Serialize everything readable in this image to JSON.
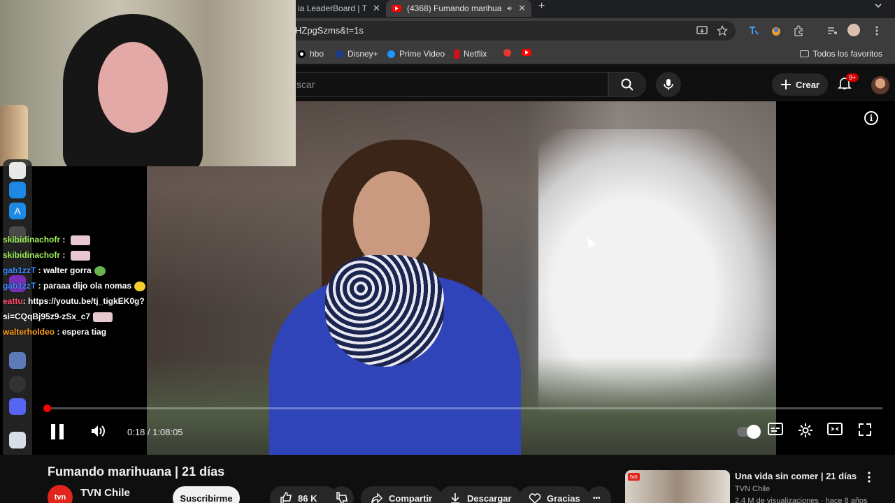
{
  "browser": {
    "tabs": [
      {
        "label": "ia LeaderBoard | T"
      },
      {
        "label": "(4368) Fumando marihua"
      }
    ],
    "close_glyph": "✕",
    "new_tab_glyph": "+",
    "url": "HZpgSzms&t=1s",
    "bookmarks": [
      {
        "label": "hbo"
      },
      {
        "label": "Disney+"
      },
      {
        "label": "Prime Video"
      },
      {
        "label": "Netflix"
      }
    ],
    "all_bookmarks": "Todos los favoritos"
  },
  "youtube": {
    "search_placeholder": "scar",
    "create_label": "Crear",
    "notifications_badge": "9+"
  },
  "chat": [
    {
      "user": "skibidinachofr",
      "sep": " : ",
      "msg": "",
      "emote": "pink",
      "color": "green"
    },
    {
      "user": "skibidinachofr",
      "sep": " : ",
      "msg": "",
      "emote": "pink",
      "color": "green"
    },
    {
      "user": "gab1zzT",
      "sep": " : ",
      "msg": "walter gorra",
      "emote": "green",
      "color": "blue"
    },
    {
      "user": "gab1zzT",
      "sep": " : ",
      "msg": "paraaa dijo ola nomas",
      "emote": "yellow",
      "color": "blue"
    },
    {
      "user": "eattu",
      "sep": ": ",
      "msg": "https://youtu.be/tj_tigkEK0g?",
      "emote": "",
      "color": "red"
    },
    {
      "user": "",
      "sep": "",
      "msg": "si=CQqBj95z9-zSx_c7",
      "emote": "pink",
      "color": "red"
    },
    {
      "user": "walterholdeo",
      "sep": " : ",
      "msg": "espera tiag",
      "emote": "",
      "color": "orange"
    }
  ],
  "player": {
    "current_time": "0:18",
    "separator": " / ",
    "duration": "1:08:05",
    "progress_fraction": 0.0044
  },
  "video": {
    "title": "Fumando marihuana | 21 días",
    "channel": "TVN Chile",
    "channel_avatar_text": "tvn",
    "subscribe_label": "Suscribirme",
    "likes": "86 K",
    "share_label": "Compartir",
    "download_label": "Descargar",
    "thanks_label": "Gracias",
    "more_glyph": "•••"
  },
  "suggestion": {
    "title": "Una vida sin comer | 21 días",
    "channel": "TVN Chile",
    "meta": "2,4 M de visualizaciones · hace 8 años",
    "thumb_badge": "tvn"
  },
  "colors": {
    "youtube_red": "#ff0000",
    "background": "#0f0f0f"
  }
}
